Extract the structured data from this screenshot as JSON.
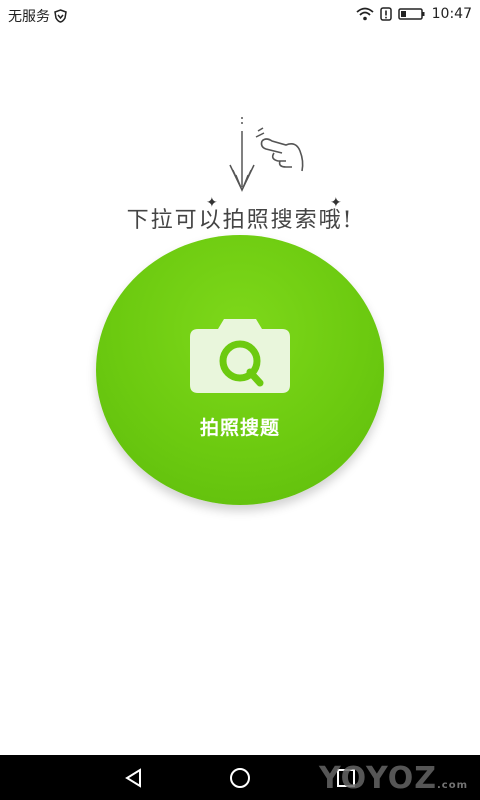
{
  "status_bar": {
    "carrier": "无服务",
    "time": "10:47"
  },
  "hint": {
    "text": "下拉可以拍照搜索哦!"
  },
  "camera_button": {
    "label": "拍照搜题",
    "color": "#6cca10"
  },
  "watermark": {
    "text": "YOYOZ",
    "suffix": ".com"
  },
  "icons": {
    "status_shield": "shield-icon",
    "wifi": "wifi-icon",
    "alert": "alert-icon",
    "battery": "battery-icon",
    "camera": "camera-search-icon",
    "back": "back-icon",
    "home": "home-icon",
    "recents": "recents-icon"
  }
}
